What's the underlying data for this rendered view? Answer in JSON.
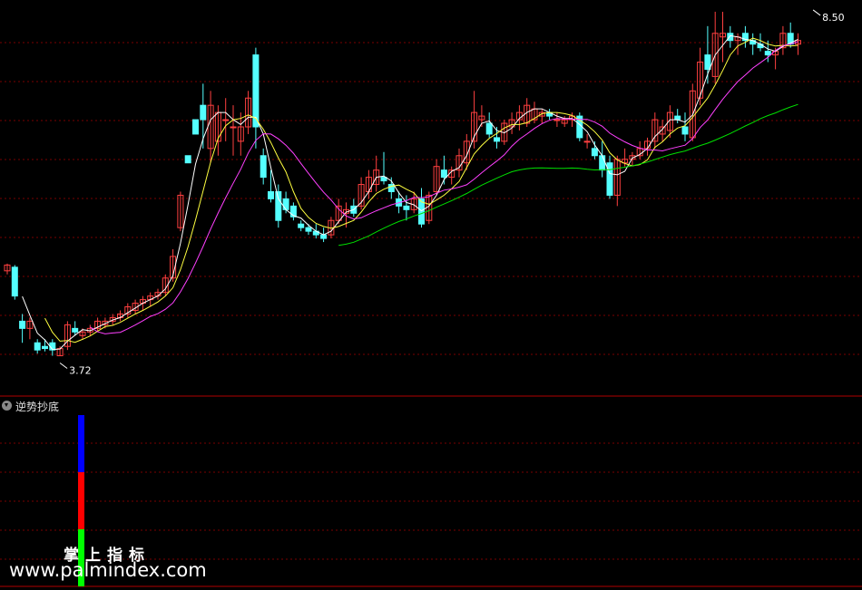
{
  "indicator_title": "逆势抄底",
  "watermark": {
    "brand": "掌上指标",
    "url": "www.palmindex.com"
  },
  "colors": {
    "background": "#000000",
    "up_candle": "#ff4040",
    "down_candle": "#54ffff",
    "ma_short": "#ffffff",
    "ma_mid": "#ffff40",
    "ma_long": "#ff40ff",
    "ma_longest": "#00e000",
    "grid": "#7a0000",
    "panel_border": "#b00000",
    "bar_top": "#0000ff",
    "bar_mid": "#ff0000",
    "bar_bottom": "#00ff00"
  },
  "chart_data": {
    "type": "candlestick",
    "annotations": {
      "high_label": "8.50",
      "low_label": "3.72"
    },
    "price_range": [
      3.5,
      8.6
    ],
    "candles": [
      [
        4.9,
        5.0,
        4.85,
        4.98
      ],
      [
        4.95,
        4.98,
        4.5,
        4.55
      ],
      [
        4.2,
        4.3,
        3.9,
        4.1
      ],
      [
        4.1,
        4.25,
        3.95,
        4.2
      ],
      [
        3.9,
        3.95,
        3.75,
        3.8
      ],
      [
        3.85,
        3.95,
        3.78,
        3.82
      ],
      [
        3.9,
        3.95,
        3.72,
        3.8
      ],
      [
        3.72,
        3.85,
        3.72,
        3.82
      ],
      [
        3.85,
        4.2,
        3.8,
        4.15
      ],
      [
        4.1,
        4.2,
        4.0,
        4.05
      ],
      [
        4.0,
        4.1,
        3.95,
        4.05
      ],
      [
        4.05,
        4.15,
        4.0,
        4.1
      ],
      [
        4.1,
        4.25,
        4.05,
        4.2
      ],
      [
        4.15,
        4.25,
        4.1,
        4.2
      ],
      [
        4.2,
        4.3,
        4.15,
        4.25
      ],
      [
        4.25,
        4.35,
        4.2,
        4.3
      ],
      [
        4.3,
        4.45,
        4.25,
        4.4
      ],
      [
        4.35,
        4.5,
        4.3,
        4.45
      ],
      [
        4.45,
        4.55,
        4.35,
        4.5
      ],
      [
        4.5,
        4.6,
        4.4,
        4.55
      ],
      [
        4.55,
        4.65,
        4.5,
        4.6
      ],
      [
        4.6,
        4.85,
        4.55,
        4.8
      ],
      [
        4.8,
        5.2,
        4.75,
        5.1
      ],
      [
        5.5,
        6.0,
        5.45,
        5.95
      ],
      [
        6.5,
        6.5,
        6.4,
        6.4
      ],
      [
        7.0,
        7.0,
        6.8,
        6.8
      ],
      [
        7.2,
        7.5,
        6.6,
        7.0
      ],
      [
        6.6,
        7.4,
        6.4,
        7.2
      ],
      [
        6.7,
        7.2,
        6.5,
        7.1
      ],
      [
        7.0,
        7.3,
        6.7,
        7.0
      ],
      [
        6.9,
        7.2,
        6.5,
        6.9
      ],
      [
        6.7,
        7.1,
        6.5,
        6.9
      ],
      [
        6.9,
        7.4,
        6.8,
        7.3
      ],
      [
        7.9,
        8.0,
        6.6,
        6.9
      ],
      [
        6.5,
        6.6,
        6.1,
        6.2
      ],
      [
        6.0,
        6.3,
        5.85,
        5.9
      ],
      [
        6.0,
        6.1,
        5.5,
        5.6
      ],
      [
        5.9,
        6.0,
        5.7,
        5.75
      ],
      [
        5.8,
        5.85,
        5.6,
        5.65
      ],
      [
        5.55,
        5.6,
        5.45,
        5.5
      ],
      [
        5.5,
        5.55,
        5.4,
        5.45
      ],
      [
        5.45,
        5.55,
        5.35,
        5.4
      ],
      [
        5.4,
        5.5,
        5.3,
        5.35
      ],
      [
        5.4,
        5.65,
        5.35,
        5.6
      ],
      [
        5.6,
        5.9,
        5.55,
        5.8
      ],
      [
        5.7,
        5.85,
        5.5,
        5.75
      ],
      [
        5.8,
        5.9,
        5.65,
        5.7
      ],
      [
        5.8,
        6.2,
        5.75,
        6.1
      ],
      [
        6.0,
        6.3,
        5.9,
        6.2
      ],
      [
        6.1,
        6.5,
        6.0,
        6.3
      ],
      [
        6.2,
        6.55,
        6.1,
        6.15
      ],
      [
        6.1,
        6.2,
        5.9,
        6.0
      ],
      [
        5.9,
        6.0,
        5.7,
        5.8
      ],
      [
        5.8,
        5.95,
        5.6,
        5.75
      ],
      [
        5.75,
        6.0,
        5.7,
        5.9
      ],
      [
        5.9,
        6.05,
        5.5,
        5.55
      ],
      [
        5.6,
        6.0,
        5.55,
        5.95
      ],
      [
        6.0,
        6.45,
        5.95,
        6.35
      ],
      [
        6.3,
        6.5,
        6.1,
        6.2
      ],
      [
        6.2,
        6.35,
        6.1,
        6.3
      ],
      [
        6.3,
        6.6,
        6.2,
        6.5
      ],
      [
        6.4,
        6.8,
        6.3,
        6.7
      ],
      [
        6.7,
        7.4,
        6.6,
        7.1
      ],
      [
        7.0,
        7.2,
        6.9,
        7.05
      ],
      [
        6.95,
        7.1,
        6.75,
        6.8
      ],
      [
        6.75,
        6.9,
        6.6,
        6.7
      ],
      [
        6.7,
        7.0,
        6.65,
        6.95
      ],
      [
        6.9,
        7.1,
        6.8,
        7.0
      ],
      [
        7.0,
        7.2,
        6.85,
        7.1
      ],
      [
        6.95,
        7.3,
        6.9,
        7.2
      ],
      [
        7.0,
        7.25,
        6.95,
        7.15
      ],
      [
        7.05,
        7.15,
        6.95,
        7.1
      ],
      [
        7.1,
        7.15,
        7.0,
        7.05
      ],
      [
        7.0,
        7.1,
        6.9,
        7.0
      ],
      [
        6.95,
        7.05,
        6.9,
        7.0
      ],
      [
        7.0,
        7.1,
        6.9,
        7.05
      ],
      [
        7.05,
        7.1,
        6.7,
        6.75
      ],
      [
        6.7,
        6.8,
        6.6,
        6.7
      ],
      [
        6.6,
        6.7,
        6.45,
        6.5
      ],
      [
        6.5,
        6.7,
        6.2,
        6.3
      ],
      [
        6.4,
        6.5,
        5.9,
        5.95
      ],
      [
        5.95,
        6.5,
        5.8,
        6.45
      ],
      [
        6.4,
        6.6,
        6.35,
        6.45
      ],
      [
        6.45,
        6.55,
        6.35,
        6.5
      ],
      [
        6.5,
        6.7,
        6.45,
        6.6
      ],
      [
        6.6,
        6.75,
        6.5,
        6.7
      ],
      [
        6.7,
        7.1,
        6.6,
        7.0
      ],
      [
        6.8,
        7.0,
        6.7,
        6.9
      ],
      [
        6.85,
        7.2,
        6.75,
        7.1
      ],
      [
        7.05,
        7.15,
        6.95,
        7.0
      ],
      [
        6.9,
        7.1,
        6.7,
        6.8
      ],
      [
        6.75,
        7.5,
        6.7,
        7.4
      ],
      [
        7.3,
        8.0,
        7.2,
        7.8
      ],
      [
        7.9,
        8.3,
        7.5,
        7.7
      ],
      [
        7.6,
        8.5,
        7.5,
        8.2
      ],
      [
        8.15,
        8.5,
        7.8,
        8.2
      ],
      [
        8.2,
        8.3,
        8.0,
        8.1
      ],
      [
        8.1,
        8.2,
        7.9,
        8.15
      ],
      [
        8.2,
        8.3,
        8.0,
        8.1
      ],
      [
        8.1,
        8.2,
        7.9,
        8.05
      ],
      [
        8.05,
        8.2,
        7.95,
        8.0
      ],
      [
        7.95,
        8.1,
        7.8,
        7.9
      ],
      [
        7.9,
        8.0,
        7.7,
        7.95
      ],
      [
        8.0,
        8.3,
        7.9,
        8.2
      ],
      [
        8.2,
        8.35,
        8.0,
        8.05
      ],
      [
        8.05,
        8.2,
        7.9,
        8.1
      ]
    ],
    "indicator": {
      "name": "逆势抄底",
      "stacked_segments": [
        {
          "color": "blue",
          "value": 1
        },
        {
          "color": "red",
          "value": 1
        },
        {
          "color": "green",
          "value": 1
        }
      ]
    }
  }
}
